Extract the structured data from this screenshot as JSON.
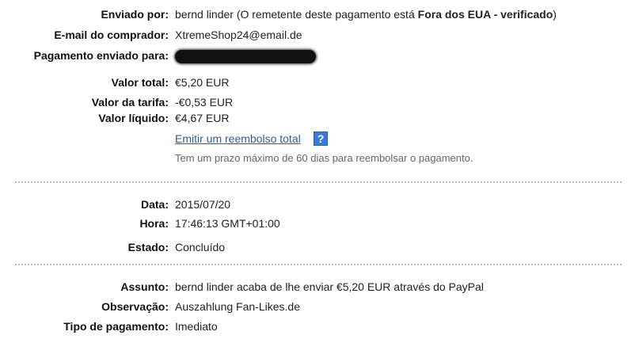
{
  "details": {
    "sent_by_label": "Enviado por:",
    "sent_by_name": "bernd linder",
    "sent_by_note_open": " (O remetente deste pagamento está ",
    "sent_by_status": "Fora dos EUA - verificado",
    "sent_by_note_close": ")",
    "buyer_email_label": "E-mail do comprador:",
    "buyer_email": "XtremeShop24@email.de",
    "sent_to_label": "Pagamento enviado para:",
    "total_label": "Valor total:",
    "total_value": "€5,20 EUR",
    "fee_label": "Valor da tarifa:",
    "fee_value": "-€0,53 EUR",
    "net_label": "Valor líquido:",
    "net_value": "€4,67 EUR",
    "refund_link": "Emitir um reembolso total",
    "help_icon_glyph": "?",
    "refund_note": "Tem um prazo máximo de 60 dias para reembolsar o pagamento."
  },
  "status": {
    "date_label": "Data:",
    "date_value": "2015/07/20",
    "time_label": "Hora:",
    "time_value": "17:46:13 GMT+01:00",
    "state_label": "Estado:",
    "state_value": "Concluído"
  },
  "message": {
    "subject_label": "Assunto:",
    "subject_value": "bernd linder acaba de lhe enviar €5,20 EUR através do PayPal",
    "note_label": "Observação:",
    "note_value": "Auszahlung Fan-Likes.de",
    "type_label": "Tipo de pagamento:",
    "type_value": "Imediato"
  },
  "colors": {
    "link": "#2b5c9e",
    "help_icon": "#3a7ad9",
    "muted_text": "#666666"
  }
}
